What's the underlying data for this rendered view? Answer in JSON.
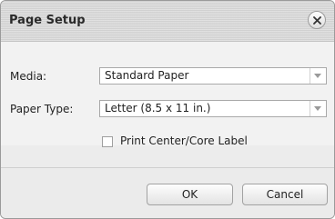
{
  "dialog": {
    "title": "Page Setup",
    "close_icon": "close-x-icon"
  },
  "form": {
    "media_label": "Media:",
    "media_value": "Standard Paper",
    "paper_type_label": "Paper Type:",
    "paper_type_value": "Letter (8.5 x 11 in.)",
    "print_label_checkbox_text": "Print Center/Core Label",
    "print_label_checked": false,
    "dropdown_icon": "chevron-down-icon"
  },
  "buttons": {
    "ok_label": "OK",
    "cancel_label": "Cancel"
  }
}
